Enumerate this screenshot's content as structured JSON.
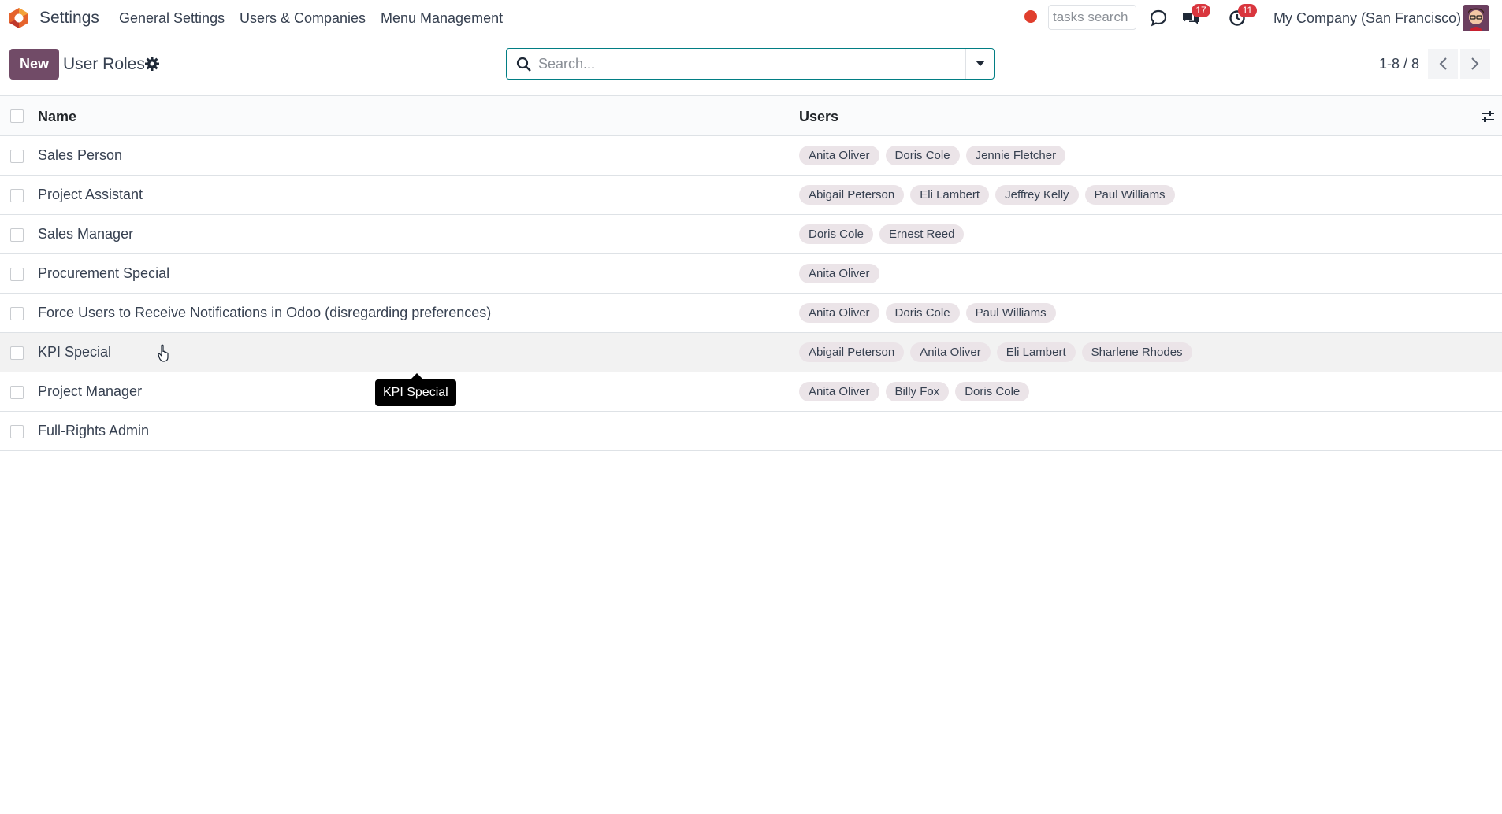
{
  "navbar": {
    "app_name": "Settings",
    "menu": [
      "General Settings",
      "Users & Companies",
      "Menu Management"
    ],
    "tasks_search_placeholder": "tasks search",
    "messages_count": "17",
    "activities_count": "11",
    "company": "My Company (San Francisco)"
  },
  "control_panel": {
    "new_label": "New",
    "title": "User Roles",
    "search_placeholder": "Search...",
    "pager": "1-8 / 8"
  },
  "list": {
    "columns": [
      "Name",
      "Users"
    ],
    "rows": [
      {
        "name": "Sales Person",
        "users": [
          "Anita Oliver",
          "Doris Cole",
          "Jennie Fletcher"
        ]
      },
      {
        "name": "Project Assistant",
        "users": [
          "Abigail Peterson",
          "Eli Lambert",
          "Jeffrey Kelly",
          "Paul Williams"
        ]
      },
      {
        "name": "Sales Manager",
        "users": [
          "Doris Cole",
          "Ernest Reed"
        ]
      },
      {
        "name": "Procurement Special",
        "users": [
          "Anita Oliver"
        ]
      },
      {
        "name": "Force Users to Receive Notifications in Odoo (disregarding preferences)",
        "users": [
          "Anita Oliver",
          "Doris Cole",
          "Paul Williams"
        ]
      },
      {
        "name": "KPI Special",
        "users": [
          "Abigail Peterson",
          "Anita Oliver",
          "Eli Lambert",
          "Sharlene Rhodes"
        ]
      },
      {
        "name": "Project Manager",
        "users": [
          "Anita Oliver",
          "Billy Fox",
          "Doris Cole"
        ]
      },
      {
        "name": "Full-Rights Admin",
        "users": []
      }
    ]
  },
  "tooltip": {
    "text": "KPI Special"
  },
  "colors": {
    "brand": "#714b67",
    "accent": "#017e84",
    "badge": "#d9363e",
    "tag_bg": "#ebe4e8",
    "rec_dot": "#e03e2d"
  },
  "icons": [
    "odoo-logo-icon",
    "search-icon",
    "dropdown-caret-icon",
    "gear-icon",
    "chevron-left-icon",
    "chevron-right-icon",
    "chat-bubble-icon",
    "messages-icon",
    "clock-icon",
    "optional-columns-icon",
    "pointer-cursor-icon"
  ]
}
